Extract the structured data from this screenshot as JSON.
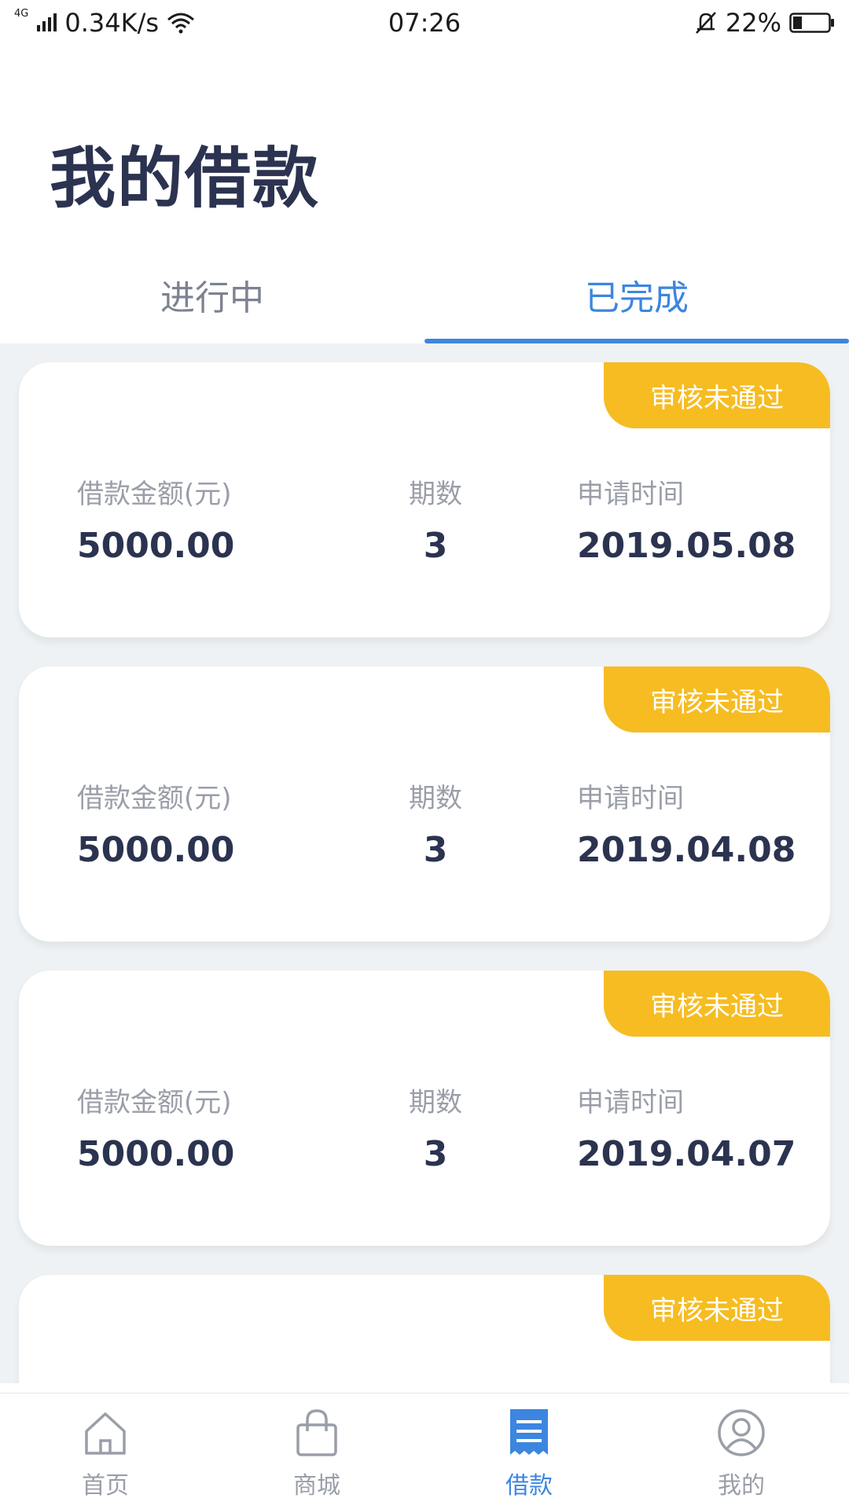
{
  "status_bar": {
    "network": "4G",
    "speed": "0.34K/s",
    "time": "07:26",
    "battery": "22%"
  },
  "header": {
    "title": "我的借款"
  },
  "tabs": [
    {
      "label": "进行中",
      "active": false
    },
    {
      "label": "已完成",
      "active": true
    }
  ],
  "columns": {
    "amount": "借款金额(元)",
    "periods": "期数",
    "date": "申请时间"
  },
  "loans": [
    {
      "status": "审核未通过",
      "amount": "5000.00",
      "periods": "3",
      "date": "2019.05.08"
    },
    {
      "status": "审核未通过",
      "amount": "5000.00",
      "periods": "3",
      "date": "2019.04.08"
    },
    {
      "status": "审核未通过",
      "amount": "5000.00",
      "periods": "3",
      "date": "2019.04.07"
    },
    {
      "status": "审核未通过"
    }
  ],
  "bottom_nav": [
    {
      "label": "首页",
      "icon": "home-icon",
      "active": false
    },
    {
      "label": "商城",
      "icon": "shopping-bag-icon",
      "active": false
    },
    {
      "label": "借款",
      "icon": "receipt-icon",
      "active": true
    },
    {
      "label": "我的",
      "icon": "user-icon",
      "active": false
    }
  ],
  "colors": {
    "accent": "#3c86e0",
    "badge": "#f6bc21",
    "title": "#2b3350",
    "muted": "#9a9ea8"
  }
}
